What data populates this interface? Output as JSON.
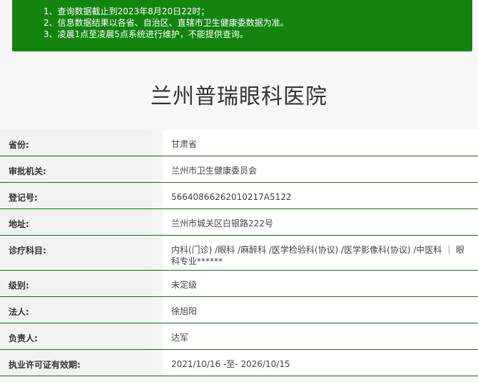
{
  "notice": {
    "lines": [
      "1、查询数据截止到2023年8月20日22时；",
      "2、信息数据结果以各省、自治区、直辖市卫生健康委数据为准。",
      "3、凌晨1点至凌晨5点系统进行维护，不能提供查询。"
    ]
  },
  "hospital": {
    "name": "兰州普瑞眼科医院"
  },
  "details": [
    {
      "label": "省份:",
      "value": "甘肃省"
    },
    {
      "label": "审批机关:",
      "value": "兰州市卫生健康委员会"
    },
    {
      "label": "登记号:",
      "value": "56640866262010217A5122"
    },
    {
      "label": "地址:",
      "value": "兰州市城关区白银路222号"
    },
    {
      "label": "诊疗科目:",
      "value": "内科(门诊) /眼科 /麻醉科 /医学检验科(协议) /医学影像科(协议) /中医科 ｜ 眼科专业******"
    },
    {
      "label": "级别:",
      "value": "未定级"
    },
    {
      "label": "法人:",
      "value": "徐旭阳"
    },
    {
      "label": "负责人:",
      "value": "达军"
    },
    {
      "label": "执业许可证有效期:",
      "value": "2021/10/16 -至- 2026/10/15"
    }
  ],
  "colors": {
    "notice_bg": "#13850f",
    "row_divider": "#11711a"
  }
}
